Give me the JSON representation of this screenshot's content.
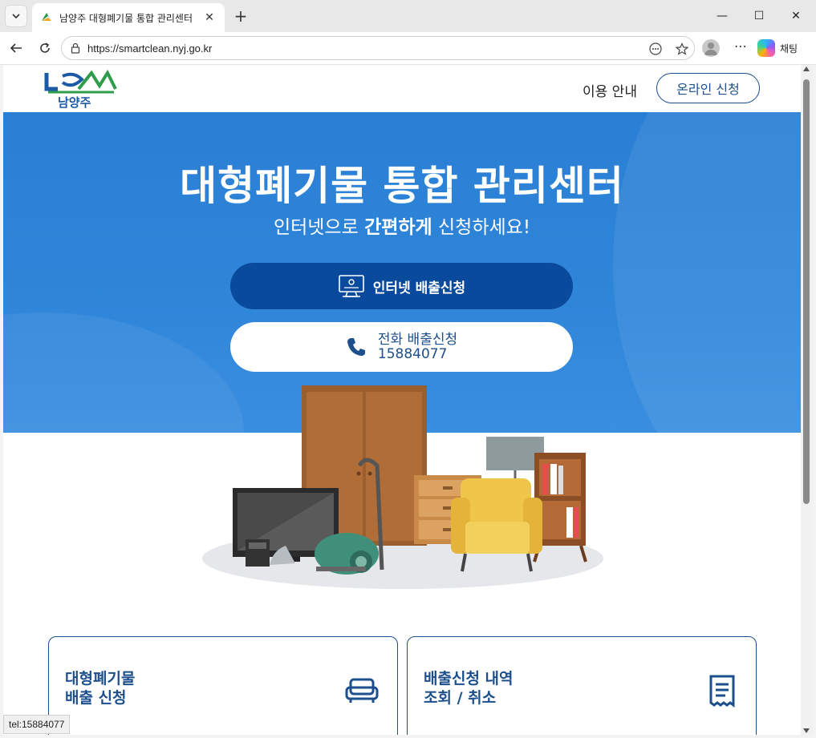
{
  "browser": {
    "tab_title": "남양주 대형폐기물 통합 관리센터",
    "tab_close": "✕",
    "new_tab": "+",
    "url": "https://smartclean.nyj.go.kr",
    "chat_label": "채팅",
    "window_controls": {
      "minimize": "—",
      "maximize": "☐",
      "close": "✕"
    },
    "status_text": "tel:15884077"
  },
  "site": {
    "logo_text": "남양주",
    "nav": {
      "guide": "이용 안내",
      "apply": "온라인 신청"
    },
    "hero": {
      "title": "대형폐기물 통합 관리센터",
      "subtitle_pre": "인터넷으로 ",
      "subtitle_bold": "간편하게",
      "subtitle_post": " 신청하세요!",
      "btn_online": "인터넷 배출신청",
      "btn_phone_line1": "전화 배출신청",
      "btn_phone_line2": "15884077"
    },
    "cards": [
      {
        "line1": "대형폐기물",
        "line2": "배출 신청",
        "icon": "sofa-icon"
      },
      {
        "line1": "배출신청 내역",
        "line2": "조회 / 취소",
        "icon": "receipt-icon"
      }
    ]
  },
  "colors": {
    "brand_blue": "#1c4f8c",
    "hero_bg": "#2f86d9",
    "btn_dark": "#0a4a9c"
  }
}
